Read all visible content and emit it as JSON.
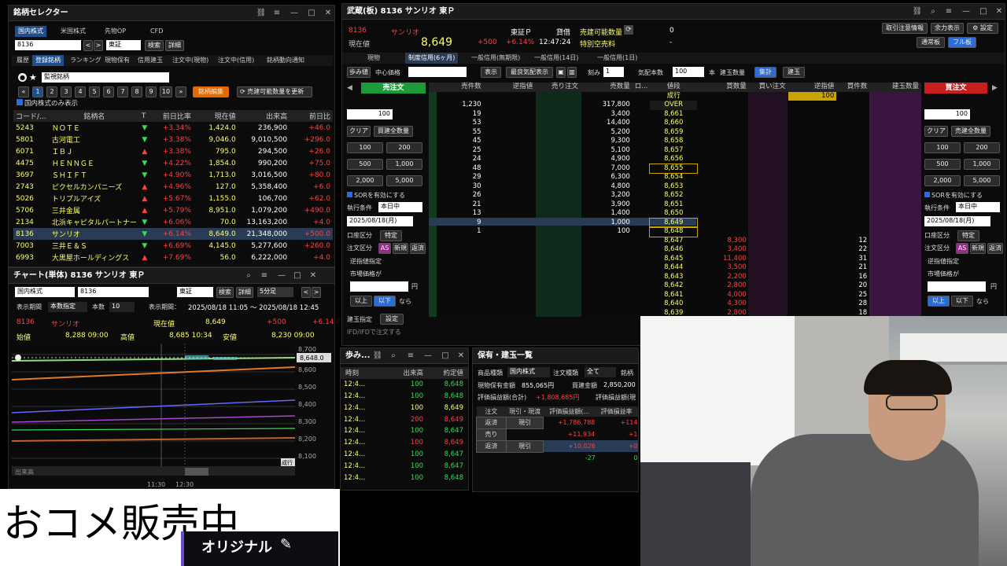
{
  "selector": {
    "title": "銘柄セレクター",
    "tabs": [
      "国内株式",
      "米国株式",
      "先物OP",
      "CFD"
    ],
    "code": "8136",
    "market": "東証",
    "search": "検索",
    "detail": "詳細",
    "subtabs": [
      "履歴",
      "登録銘柄",
      "ランキング",
      "現物保有",
      "信用建玉",
      "注文中(現物)",
      "注文中(信用)",
      "銘柄動向通知"
    ],
    "list": "監視銘柄",
    "pages": [
      "1",
      "2",
      "3",
      "4",
      "5",
      "6",
      "7",
      "8",
      "9",
      "10"
    ],
    "edit": "銘柄編集",
    "update": "売建可能数量を更新",
    "check": "国内株式のみ表示",
    "cols": [
      "コード/...",
      "銘柄名",
      "T",
      "前日比率",
      "現在値",
      "出来高",
      "前日比"
    ],
    "rows": [
      {
        "c": "5243",
        "n": "ＮＯＴＥ",
        "t": "▼",
        "r": "+3.34%",
        "p": "1,424.0",
        "v": "236,900",
        "d": "+46.0"
      },
      {
        "c": "5801",
        "n": "古河電工",
        "t": "▼",
        "r": "+3.38%",
        "p": "9,046.0",
        "v": "9,010,500",
        "d": "+296.0"
      },
      {
        "c": "6071",
        "n": "ＩＢＪ",
        "t": "▲",
        "r": "+3.38%",
        "p": "795.0",
        "v": "294,500",
        "d": "+26.0"
      },
      {
        "c": "4475",
        "n": "ＨＥＮＮＧＥ",
        "t": "▼",
        "r": "+4.22%",
        "p": "1,854.0",
        "v": "990,200",
        "d": "+75.0"
      },
      {
        "c": "3697",
        "n": "ＳＨＩＦＴ",
        "t": "▼",
        "r": "+4.90%",
        "p": "1,713.0",
        "v": "3,016,500",
        "d": "+80.0"
      },
      {
        "c": "2743",
        "n": "ピクセルカンパニーズ",
        "t": "▲",
        "r": "+4.96%",
        "p": "127.0",
        "v": "5,358,400",
        "d": "+6.0"
      },
      {
        "c": "5026",
        "n": "トリプルアイズ",
        "t": "▲",
        "r": "+5.67%",
        "p": "1,155.0",
        "v": "106,700",
        "d": "+62.0"
      },
      {
        "c": "5706",
        "n": "三井金属",
        "t": "▲",
        "r": "+5.79%",
        "p": "8,951.0",
        "v": "1,079,200",
        "d": "+490.0"
      },
      {
        "c": "2134",
        "n": "北浜キャピタルパートナー",
        "t": "▼",
        "r": "+6.06%",
        "p": "70.0",
        "v": "13,163,200",
        "d": "+4.0"
      },
      {
        "c": "8136",
        "n": "サンリオ",
        "t": "▼",
        "r": "+6.14%",
        "p": "8,649.0",
        "v": "21,348,000",
        "d": "+500.0"
      },
      {
        "c": "7003",
        "n": "三井Ｅ＆Ｓ",
        "t": "▼",
        "r": "+6.69%",
        "p": "4,145.0",
        "v": "5,277,600",
        "d": "+260.0"
      },
      {
        "c": "6993",
        "n": "大黒屋ホールディングス",
        "t": "▲",
        "r": "+7.69%",
        "p": "56.0",
        "v": "6,222,000",
        "d": "+4.0"
      }
    ]
  },
  "chart": {
    "title": "チャート(単体) 8136 サンリオ 東Ｐ",
    "market": "国内株式",
    "code": "8136",
    "ex": "東証",
    "search": "検索",
    "detail": "詳細",
    "interval": "5分足",
    "period_label": "表示期間",
    "period_type": "本数指定",
    "count_label": "本数",
    "count": "10",
    "range_label": "表示期間：",
    "range": "2025/08/18 11:05 ～ 2025/08/18 12:45",
    "code2": "8136",
    "name": "サンリオ",
    "now_label": "現在値",
    "now": "8,649",
    "chg": "+500",
    "chgp": "+6.14",
    "open_label": "始値",
    "open": "8,288 09:00",
    "high_label": "高値",
    "high": "8,685 10:34",
    "low_label": "安値",
    "low": "8,230 09:00",
    "price_tag": "8,648.0",
    "yaxis": [
      "8,700",
      "8,600",
      "8,500",
      "8,400",
      "8,300",
      "8,200",
      "8,100"
    ],
    "xaxis": [
      "11:30",
      "12:30"
    ],
    "vol": "出来高",
    "badge": "成行"
  },
  "board": {
    "title": "武蔵(板) 8136 サンリオ 東Ｐ",
    "code": "8136",
    "name": "サンリオ",
    "now_label": "現在値",
    "price": "8,649",
    "chg": "+500",
    "chgp": "+6.14%",
    "time": "12:47:24",
    "mkt": "東証Ｐ",
    "lend": "貸借",
    "short_label": "売建可能数量",
    "short_val": "0",
    "special_label": "特別空売料",
    "special_val": "-",
    "topbtns": [
      "取引注意情報",
      "余力表示",
      "設定"
    ],
    "toggles": [
      "通常板",
      "フル板"
    ],
    "tabs": [
      "現物",
      "制度信用(6ヶ月)",
      "一般信用(無期限)",
      "一般信用(14日)",
      "一般信用(1日)"
    ],
    "tool": [
      "歩み値",
      "中心価格",
      "表示",
      "最良気配表示",
      "刻み",
      "1",
      "気配本数",
      "100",
      "本",
      "建玉数量",
      "集計",
      "建玉"
    ],
    "cols": [
      "売件数",
      "逆指値",
      "売り注文",
      "売数量",
      "ロ...",
      "値段",
      "買数量",
      "買い注文",
      "逆指値",
      "買件数",
      "建玉数量"
    ],
    "market_row": {
      "sc": "1,230",
      "sq": "317,800",
      "p": "OVER",
      "bq": ""
    },
    "ask": [
      {
        "sc": "19",
        "sq": "3,400",
        "p": "8,661"
      },
      {
        "sc": "53",
        "sq": "14,400",
        "p": "8,660"
      },
      {
        "sc": "55",
        "sq": "5,200",
        "p": "8,659"
      },
      {
        "sc": "45",
        "sq": "9,300",
        "p": "8,658"
      },
      {
        "sc": "25",
        "sq": "5,100",
        "p": "8,657"
      },
      {
        "sc": "24",
        "sq": "4,900",
        "p": "8,656"
      },
      {
        "sc": "48",
        "sq": "7,000",
        "p": "8,655"
      },
      {
        "sc": "29",
        "sq": "6,300",
        "p": "8,654"
      },
      {
        "sc": "30",
        "sq": "4,800",
        "p": "8,653"
      },
      {
        "sc": "26",
        "sq": "3,200",
        "p": "8,652"
      },
      {
        "sc": "21",
        "sq": "3,900",
        "p": "8,651"
      },
      {
        "sc": "13",
        "sq": "1,400",
        "p": "8,650"
      },
      {
        "sc": "9",
        "sq": "1,000",
        "p": "8,649"
      },
      {
        "sc": "1",
        "sq": "100",
        "p": "8,648"
      }
    ],
    "bid": [
      {
        "p": "8,647",
        "bq": "8,300",
        "bc": "12"
      },
      {
        "p": "8,646",
        "bq": "3,400",
        "bc": "22"
      },
      {
        "p": "8,645",
        "bq": "11,400",
        "bc": "31"
      },
      {
        "p": "8,644",
        "bq": "3,500",
        "bc": "21"
      },
      {
        "p": "8,643",
        "bq": "2,200",
        "bc": "16"
      },
      {
        "p": "8,642",
        "bq": "2,800",
        "bc": "20"
      },
      {
        "p": "8,641",
        "bq": "4,000",
        "bc": "25"
      },
      {
        "p": "8,640",
        "bq": "4,300",
        "bc": "28"
      },
      {
        "p": "8,639",
        "bq": "2,800",
        "bc": "18"
      }
    ],
    "nariyuki": "成行",
    "my_order": "100",
    "sell": {
      "head": "売注文",
      "qty": "100",
      "clear": "クリア",
      "all": "買建全数量",
      "q": [
        "100",
        "200",
        "500",
        "1,000",
        "2,000",
        "5,000"
      ],
      "sor": "SORを有効にする",
      "cond_label": "執行条件",
      "cond": "本日中",
      "date": "2025/08/18(月)",
      "acct_label": "口座区分",
      "acct": "特定",
      "type_label": "注文区分",
      "as": "AS",
      "new": "新規",
      "close": "返済",
      "gyaku": "逆指値指定",
      "price_label": "市場価格が",
      "yen": "円",
      "ijo": "以上",
      "ika": "以下",
      "nara": "なら",
      "tate": "建玉指定",
      "set": "設定",
      "ifd": "IFD/IFDで注文する"
    },
    "buy": {
      "head": "買注文",
      "qty": "100",
      "clear": "クリア",
      "all": "売建全数量",
      "q": [
        "100",
        "200",
        "500",
        "1,000",
        "2,000",
        "5,000"
      ],
      "sor": "SORを有効にする",
      "cond_label": "執行条件",
      "cond": "本日中",
      "date": "2025/08/18(月)",
      "acct_label": "口座区分",
      "acct": "特定",
      "type_label": "注文区分",
      "as": "AS",
      "new": "新規",
      "close": "返済",
      "gyaku": "逆指値指定",
      "price_label": "市場価格が",
      "yen": "円",
      "ijo": "以上",
      "ika": "以下",
      "nara": "なら"
    }
  },
  "ticks": {
    "title": "歩み...",
    "cols": [
      "時刻",
      "出来高",
      "約定値"
    ],
    "rows": [
      {
        "t": "12:4...",
        "v": "100",
        "p": "8,648",
        "c": "g"
      },
      {
        "t": "12:4...",
        "v": "100",
        "p": "8,648",
        "c": "g"
      },
      {
        "t": "12:4...",
        "v": "100",
        "p": "8,649",
        "c": "y"
      },
      {
        "t": "12:4...",
        "v": "200",
        "p": "8,649",
        "c": "r"
      },
      {
        "t": "12:4...",
        "v": "100",
        "p": "8,647",
        "c": "g"
      },
      {
        "t": "12:4...",
        "v": "100",
        "p": "8,649",
        "c": "r"
      },
      {
        "t": "12:4...",
        "v": "100",
        "p": "8,647",
        "c": "g"
      },
      {
        "t": "12:4...",
        "v": "100",
        "p": "8,647",
        "c": "g"
      },
      {
        "t": "12:4...",
        "v": "100",
        "p": "8,648",
        "c": "g"
      }
    ]
  },
  "hold": {
    "title": "保有・建玉一覧",
    "type_label": "商品種類",
    "type": "国内株式",
    "kind_label": "注文種類",
    "kind": "全て",
    "brand": "銘柄",
    "amt_label": "現物保有金額",
    "amt": "855,065円",
    "buy_label": "買建金額",
    "buy": "2,850,200",
    "pl_label": "評価損益額(合計)",
    "pl": "+1,808,685円",
    "pl2": "評価損益額(現",
    "cols": [
      "注文",
      "現引・現渡",
      "評価損益額(...",
      "評価損益率"
    ],
    "rows": [
      {
        "a": "返済",
        "b": "現引",
        "c": "+1,786,788",
        "d": "+114"
      },
      {
        "a": "売り",
        "b": "",
        "c": "+11,934",
        "d": "+1"
      },
      {
        "a": "返済",
        "b": "現引",
        "c": "+10,026",
        "d": "+0"
      },
      {
        "a": "",
        "b": "",
        "c": "-27",
        "d": "0"
      }
    ]
  },
  "overlay": {
    "big": "おコメ販売中",
    "label": "オリジナル"
  }
}
